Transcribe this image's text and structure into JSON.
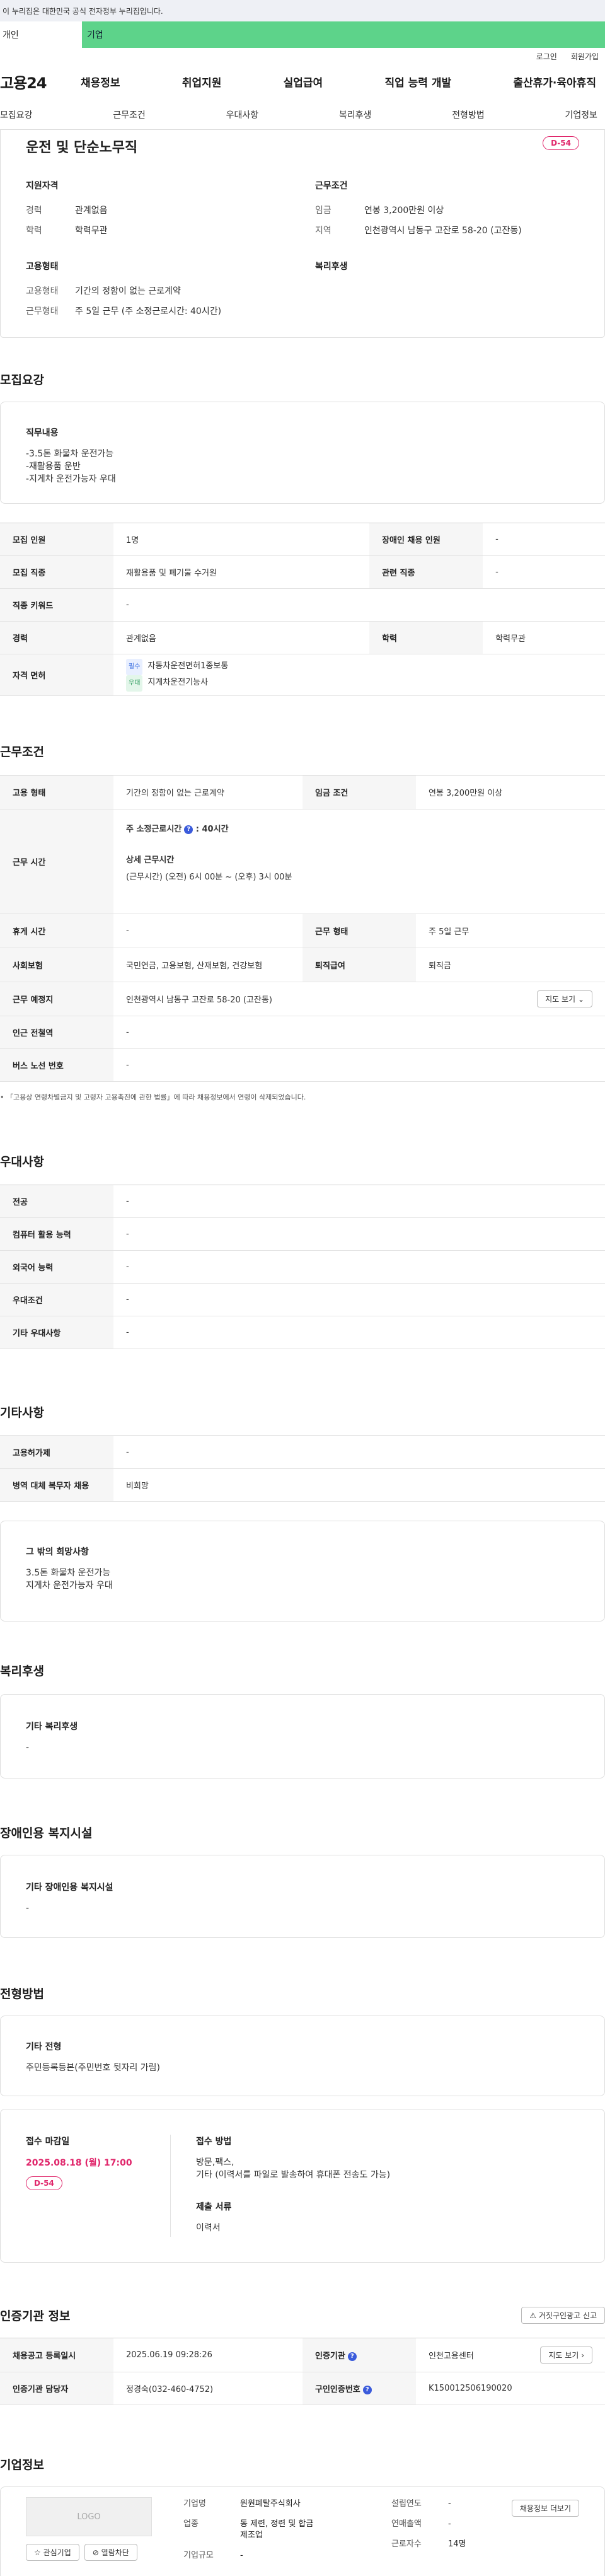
{
  "gov_banner": "이 누리집은 대한민국 공식 전자정부 누리집입니다.",
  "user_tabs": [
    "개인",
    "기업"
  ],
  "util_links": [
    "로그인",
    "회원가입"
  ],
  "logo": "고용24",
  "gnb": [
    "채용정보",
    "취업지원",
    "실업급여",
    "직업 능력 개발",
    "출산휴가·육아휴직"
  ],
  "subnav": [
    "모집요강",
    "근무조건",
    "우대사항",
    "복리후생",
    "전형방법",
    "기업정보"
  ],
  "summary": {
    "title": "운전 및 단순노무직",
    "dday": "D-54",
    "qual_title": "지원자격",
    "qual": [
      {
        "k": "경력",
        "v": "관계없음"
      },
      {
        "k": "학력",
        "v": "학력무관"
      }
    ],
    "work_title": "근무조건",
    "work": [
      {
        "k": "임금",
        "v": "연봉 3,200만원 이상"
      },
      {
        "k": "지역",
        "v": "인천광역시 남동구 고잔로 58-20 (고잔동)"
      }
    ],
    "emp_title": "고용형태",
    "emp": [
      {
        "k": "고용형태",
        "v": "기간의 정함이 없는 근로계약"
      },
      {
        "k": "근무형태",
        "v": "주 5일 근무 (주 소정근로시간: 40시간)"
      }
    ],
    "welfare_title": "복리후생"
  },
  "recruit": {
    "title": "모집요강",
    "duty_title": "직무내용",
    "duty_lines": [
      "-3.5톤 화물차 운전가능",
      "-재활용품 운반",
      "-지게차 운전가능자 우대"
    ],
    "rows": [
      {
        "k1": "모집 인원",
        "v1": "1명",
        "k2": "장애인 채용 인원",
        "v2": "-"
      },
      {
        "k1": "모집 직종",
        "v1": "재활용품 및 폐기물 수거원",
        "k2": "관련 직종",
        "v2": "-"
      },
      {
        "k1": "직종 키워드",
        "v1": "-"
      },
      {
        "k1": "경력",
        "v1": "관계없음",
        "k2": "학력",
        "v2": "학력무관"
      }
    ],
    "license_label": "자격 면허",
    "licenses": [
      {
        "tag": "필수",
        "name": "자동차운전면허1종보통"
      },
      {
        "tag": "우대",
        "name": "지게차운전기능사"
      }
    ]
  },
  "conditions": {
    "title": "근무조건",
    "emp_type_label": "고용 형태",
    "emp_type": "기간의 정함이 없는 근로계약",
    "wage_label": "임금 조건",
    "wage": "연봉 3,200만원 이상",
    "hours_label": "근무 시간",
    "weekly_hours": "주 소정근로시간",
    "weekly_hours_value": "40시간",
    "detail_hours_title": "상세 근무시간",
    "detail_hours": "(근무시간) (오전) 6시 00분 ~ (오후) 3시 00분",
    "holiday_label": "휴게 시간",
    "holiday": "-",
    "work_form_label": "근무 형태",
    "work_form": "주 5일 근무",
    "insurance_label": "사회보험",
    "insurance": "국민연금, 고용보험, 산재보험, 건강보험",
    "severance_label": "퇴직급여",
    "severance": "퇴직금",
    "place_label": "근무 예정지",
    "place": "인천광역시 남동구 고잔로 58-20 (고잔동)",
    "map_btn": "지도 보기",
    "subway_label": "인근 전철역",
    "subway": "-",
    "bus_label": "버스 노선 번호",
    "bus": "-",
    "note": "「고용상 연령차별금지 및 고령자 고용촉진에 관한 법률」에 따라 채용정보에서 연령이 삭제되었습니다."
  },
  "preference": {
    "title": "우대사항",
    "rows": [
      {
        "k": "전공",
        "v": "-"
      },
      {
        "k": "컴퓨터 활용 능력",
        "v": "-"
      },
      {
        "k": "외국어 능력",
        "v": "-"
      },
      {
        "k": "우대조건",
        "v": "-"
      },
      {
        "k": "기타 우대사항",
        "v": "-"
      }
    ]
  },
  "etc": {
    "title": "기타사항",
    "rows": [
      {
        "k": "고용허가제",
        "v": "-"
      },
      {
        "k": "병역 대체 복무자 채용",
        "v": "비희망"
      }
    ],
    "hope_title": "그 밖의 희망사항",
    "hope_lines": [
      "3.5톤 화물차 운전가능",
      "지게차 운전가능자 우대"
    ]
  },
  "welfare": {
    "title": "복리후생",
    "box_title": "기타 복리후생",
    "box_value": "-"
  },
  "disabled": {
    "title": "장애인용 복지시설",
    "box_title": "기타 장애인용 복지시설",
    "box_value": "-"
  },
  "selection": {
    "title": "전형방법",
    "box_title": "기타 전형",
    "box_value": "주민등록등본(주민번호 뒷자리 가림)",
    "deadline_title": "접수 마감일",
    "deadline": "2025.08.18 (월) 17:00",
    "dday": "D-54",
    "method_title": "접수 방법",
    "method_lines": [
      "방문,팩스,",
      "기타 (이력서를 파일로 발송하여 휴대폰 전송도 가능)"
    ],
    "docs_title": "제출 서류",
    "docs": "이력서"
  },
  "cert": {
    "title": "인증기관 정보",
    "report_btn": "거짓구인광고 신고",
    "reg_label": "채용공고 등록일시",
    "reg": "2025.06.19 09:28:26",
    "agency_label": "인증기관",
    "agency": "인천고용센터",
    "map_btn": "지도 보기",
    "manager_label": "인증기관 담당자",
    "manager": "정경숙(032-460-4752)",
    "cert_no_label": "구인인증번호",
    "cert_no": "K150012506190020"
  },
  "company": {
    "title": "기업정보",
    "logo": "LOGO",
    "fav_btn": "관심기업",
    "block_btn": "열람차단",
    "name_label": "기업명",
    "name": "원원폐탈주식회사",
    "industry_label": "업종",
    "industry": "동 제련, 정련 및 합금 제조업",
    "size_label": "기업규모",
    "size": "-",
    "founded_label": "설립연도",
    "founded": "-",
    "sales_label": "연매출액",
    "sales": "-",
    "employees_label": "근로자수",
    "employees": "14명",
    "jobs_btn": "채용정보 더보기"
  }
}
